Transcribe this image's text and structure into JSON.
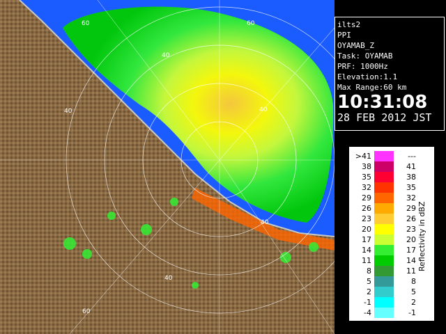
{
  "info": {
    "lines": [
      "ilts2",
      "PPI",
      "OYAMAB_Z",
      "Task: OYAMAB",
      "PRF: 1000Hz",
      "Elevation:1.1",
      "Max Range:60 km"
    ],
    "time": "10:31:08",
    "date": "28 FEB 2012 JST"
  },
  "legend": {
    "title": "Reflectivity in dBZ",
    "rows": [
      {
        "lo": ">41",
        "hi": "---",
        "color": "#ff33ff"
      },
      {
        "lo": "38",
        "hi": "41",
        "color": "#cc0066"
      },
      {
        "lo": "35",
        "hi": "38",
        "color": "#ff0033"
      },
      {
        "lo": "32",
        "hi": "35",
        "color": "#ff3300"
      },
      {
        "lo": "29",
        "hi": "32",
        "color": "#ff6600"
      },
      {
        "lo": "26",
        "hi": "29",
        "color": "#ffaa00"
      },
      {
        "lo": "23",
        "hi": "26",
        "color": "#ffcc33"
      },
      {
        "lo": "20",
        "hi": "23",
        "color": "#ffff00"
      },
      {
        "lo": "17",
        "hi": "20",
        "color": "#ccff33"
      },
      {
        "lo": "14",
        "hi": "17",
        "color": "#33ee33"
      },
      {
        "lo": "11",
        "hi": "14",
        "color": "#00cc00"
      },
      {
        "lo": "8",
        "hi": "11",
        "color": "#339933"
      },
      {
        "lo": "5",
        "hi": "8",
        "color": "#339999"
      },
      {
        "lo": "2",
        "hi": "5",
        "color": "#33cccc"
      },
      {
        "lo": "-1",
        "hi": "2",
        "color": "#00ffff"
      },
      {
        "lo": "-4",
        "hi": "-1",
        "color": "#66ffff"
      }
    ]
  },
  "map": {
    "range_labels": [
      "60",
      "60",
      "40",
      "40",
      "40",
      "40",
      "40",
      "60"
    ],
    "colors": {
      "sea": "#1a5cff",
      "land": "#8a6a45",
      "coast": "#b0b0b0"
    }
  }
}
